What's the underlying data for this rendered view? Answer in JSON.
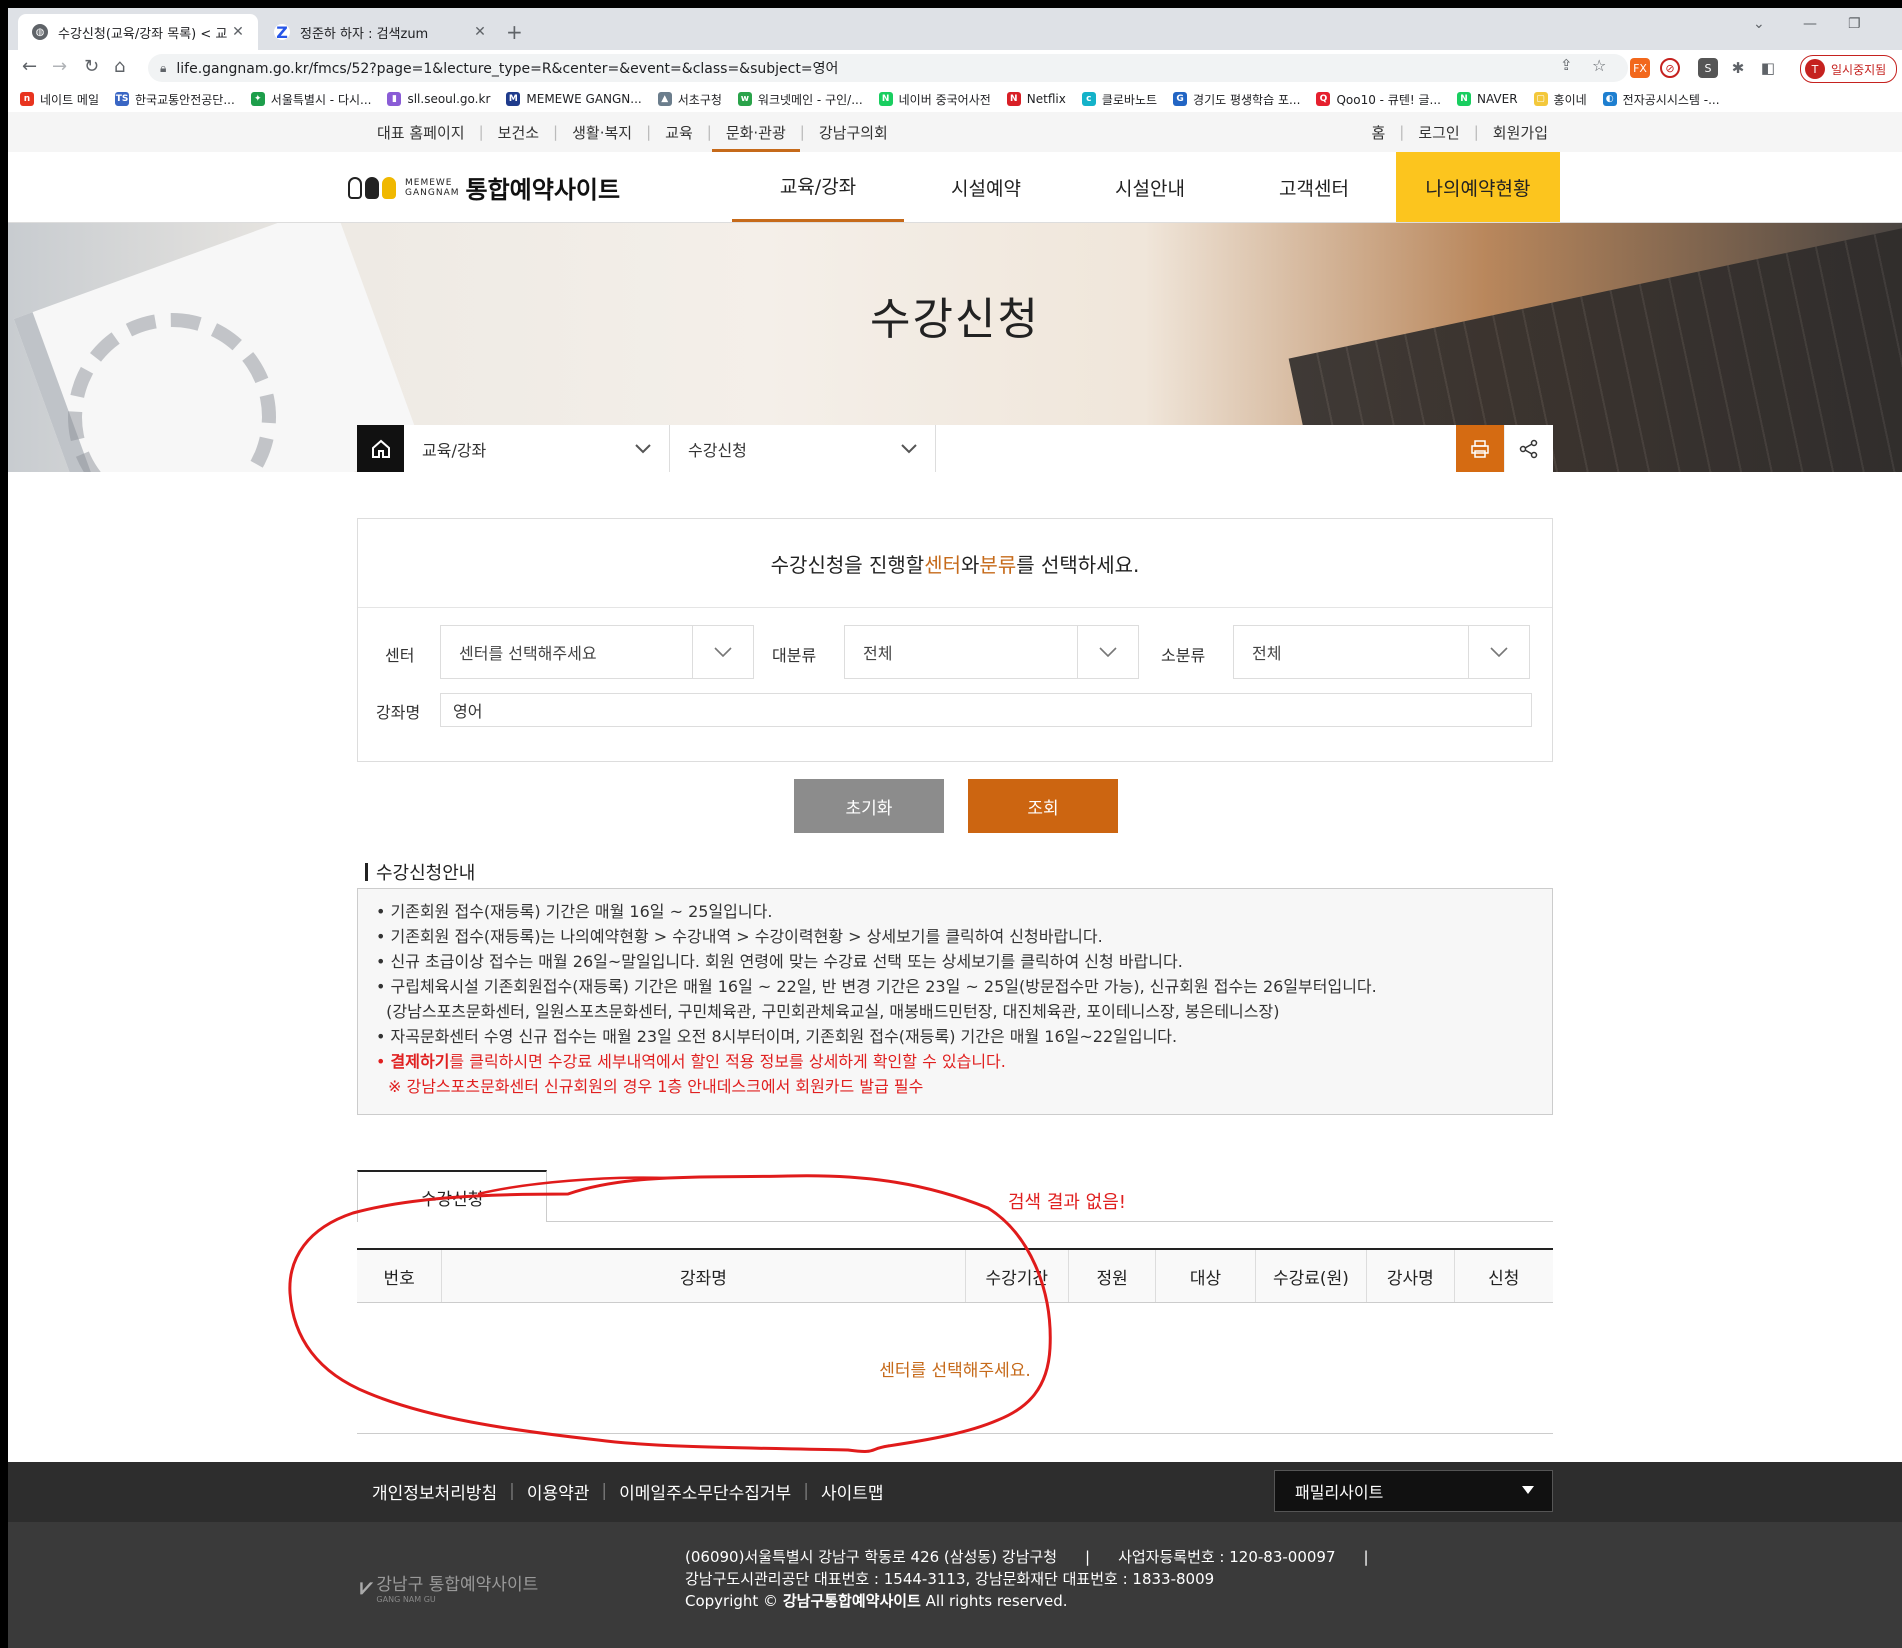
{
  "browser": {
    "tabs": [
      {
        "title": "수강신청(교육/강좌 목록) < 교육",
        "close": "✕"
      },
      {
        "title": "정준하 하자 : 검색zum",
        "close": "✕"
      }
    ],
    "new_tab": "+",
    "url": "life.gangnam.go.kr/fmcs/52?page=1&lecture_type=R&center=&event=&class=&subject=영어",
    "profile_label": "일시중지됨",
    "profile_initial": "T",
    "bookmarks": [
      {
        "label": "네이트 메일",
        "icon": "n",
        "color": "#e8341f"
      },
      {
        "label": "한국교통안전공단...",
        "icon": "TS",
        "color": "#3a66c4"
      },
      {
        "label": "서울특별시 - 다시...",
        "icon": "✦",
        "color": "#1d9e4b"
      },
      {
        "label": "sll.seoul.go.kr",
        "icon": "▮",
        "color": "#8a5cd6"
      },
      {
        "label": "MEMEWE GANGN...",
        "icon": "M",
        "color": "#1f3b8c"
      },
      {
        "label": "서초구청",
        "icon": "▲",
        "color": "#6b7d8c"
      },
      {
        "label": "워크넷메인 - 구인/...",
        "icon": "w",
        "color": "#2aa34a"
      },
      {
        "label": "네이버 중국어사전",
        "icon": "N",
        "color": "#19ce60"
      },
      {
        "label": "Netflix",
        "icon": "N",
        "color": "#d81f26"
      },
      {
        "label": "클로바노트",
        "icon": "c",
        "color": "#14b2c9"
      },
      {
        "label": "경기도 평생학습 포...",
        "icon": "G",
        "color": "#2265c4"
      },
      {
        "label": "Qoo10 - 큐텐! 글...",
        "icon": "Q",
        "color": "#e5202e"
      },
      {
        "label": "NAVER",
        "icon": "N",
        "color": "#19ce60"
      },
      {
        "label": "홍이네",
        "icon": "▢",
        "color": "#f3c83b"
      },
      {
        "label": "전자공시시스템 -...",
        "icon": "◐",
        "color": "#1e7fd0"
      }
    ]
  },
  "site": {
    "top_links_left": [
      "대표 홈페이지",
      "보건소",
      "생활·복지",
      "교육",
      "문화·관광",
      "강남구의회"
    ],
    "top_links_right": [
      "홈",
      "로그인",
      "회원가입"
    ],
    "logo": {
      "brand_line1": "MEMEWE",
      "brand_line2": "GANGNAM",
      "name": "통합예약사이트"
    },
    "menu": [
      "교육/강좌",
      "시설예약",
      "시설안내",
      "고객센터",
      "나의예약현황"
    ],
    "hero_title": "수강신청",
    "location": {
      "level1": "교육/강좌",
      "level2": "수강신청"
    }
  },
  "search": {
    "title_pre": "수강신청을 진행할 ",
    "title_hl1": "센터",
    "title_mid": "와 ",
    "title_hl2": "분류",
    "title_post": "를 선택하세요.",
    "center_label": "센터",
    "center_value": "센터를 선택해주세요",
    "major_label": "대분류",
    "major_value": "전체",
    "minor_label": "소분류",
    "minor_value": "전체",
    "name_label": "강좌명",
    "name_value": "영어",
    "reset_button": "초기화",
    "query_button": "조회"
  },
  "notice": {
    "title": "수강신청안내",
    "lines": [
      "• 기존회원 접수(재등록) 기간은 매월 16일 ~ 25일입니다.",
      "• 기존회원 접수(재등록)는 나의예약현황 > 수강내역 > 수강이력현황 > 상세보기를 클릭하여 신청바랍니다.",
      "• 신규 초급이상 접수는 매월 26일~말일입니다. 회원 연령에 맞는 수강료 선택 또는 상세보기를 클릭하여 신청 바랍니다.",
      "• 구립체육시설 기존회원접수(재등록) 기간은 매월 16일 ~ 22일, 반 변경 기간은 23일 ~ 25일(방문접수만 가능), 신규회원 접수는 26일부터입니다.",
      "  (강남스포츠문화센터, 일원스포츠문화센터, 구민체육관, 구민회관체육교실, 매봉배드민턴장, 대진체육관, 포이테니스장, 봉은테니스장)",
      "• 자곡문화센터 수영 신규 접수는 매월 23일 오전 8시부터이며, 기존회원 접수(재등록) 기간은 매월 16일~22일입니다."
    ],
    "red_bold": "결제하기",
    "red_line_rest": "를 클릭하시면 수강료 세부내역에서 할인 적용 정보를 상세하게 확인할 수 있습니다.",
    "red_line2": "※ 강남스포츠문화센터 신규회원의 경우 1층 안내데스크에서 회원카드 발급 필수"
  },
  "results": {
    "tab_label": "수강신청",
    "annotation_text": "검색 결과 없음!",
    "columns": [
      "번호",
      "강좌명",
      "수강기간",
      "정원",
      "대상",
      "수강료(원)",
      "강사명",
      "신청"
    ],
    "empty_message": "센터를 선택해주세요."
  },
  "footer": {
    "links": [
      "개인정보처리방침",
      "이용약관",
      "이메일주소무단수집거부",
      "사이트맵"
    ],
    "family_site": "패밀리사이트",
    "logo_text": "강남구 통합예약사이트",
    "logo_sub": "GANG NAM GU",
    "address_line1": "(06090)서울특별시 강남구 학동로 426 (삼성동) 강남구청",
    "biz_no": "사업자등록번호 : 120-83-00097",
    "address_line2": "강남구도시관리공단 대표번호 : 1544-3113, 강남문화재단 대표번호 : 1833-8009",
    "copyright_pre": "Copyright ©",
    "copyright_bold": "강남구통합예약사이트",
    "copyright_post": "All rights reserved."
  },
  "colors": {
    "accent": "#cc6511",
    "reserve": "#fcc51e",
    "annotation": "#e02020"
  }
}
